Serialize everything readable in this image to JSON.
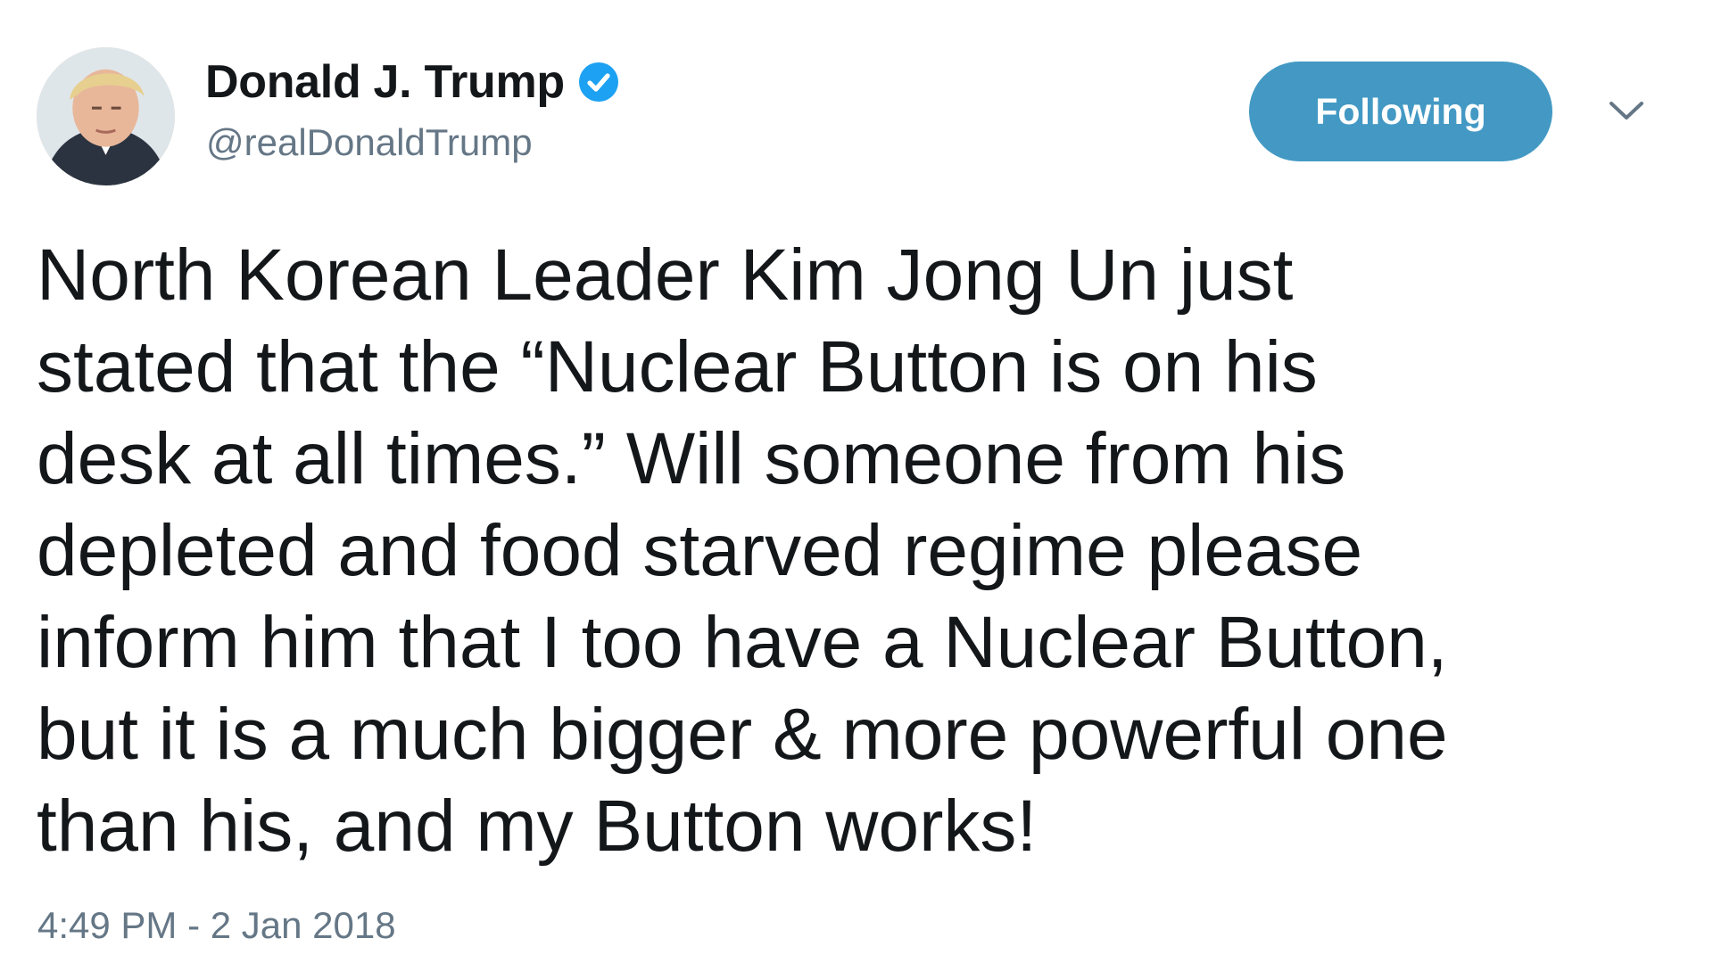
{
  "author": {
    "display_name": "Donald J. Trump",
    "handle": "@realDonaldTrump",
    "verified": true,
    "avatar_icon": "profile-photo"
  },
  "actions": {
    "follow_label": "Following",
    "menu_icon": "chevron-down-icon"
  },
  "tweet": {
    "lines": [
      "North Korean Leader Kim Jong Un just",
      "stated that the “Nuclear Button is on his",
      "desk at all times.” Will someone from his",
      "depleted and food starved regime please",
      "inform him that I too have a Nuclear Button,",
      "but it is a much bigger & more powerful one",
      "than his, and my Button works!"
    ],
    "timestamp": "4:49 PM - 2 Jan 2018"
  },
  "colors": {
    "follow_button": "#4399c4",
    "verified_badge": "#1da1f2",
    "secondary_text": "#657786",
    "primary_text": "#14171a"
  }
}
